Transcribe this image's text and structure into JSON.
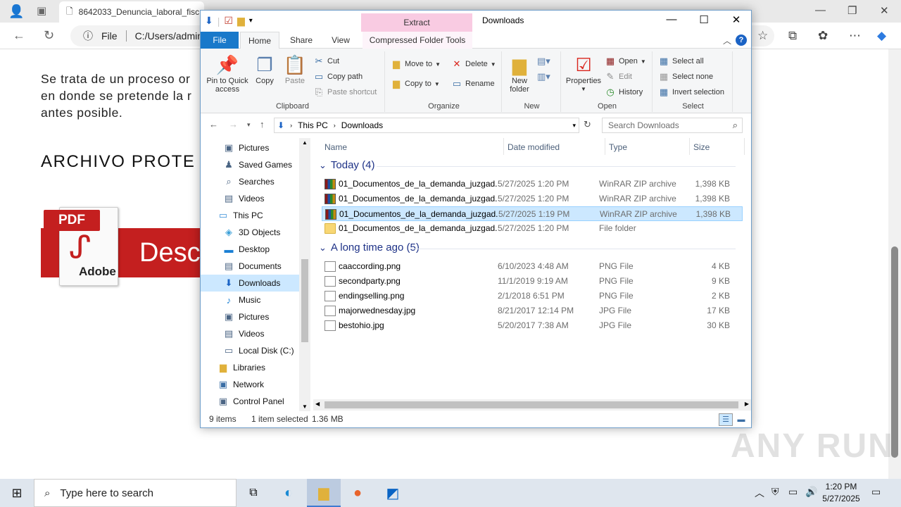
{
  "browser": {
    "tab_title": "8642033_Denuncia_laboral_fisc:",
    "address_label": "File",
    "address_value": "C:/Users/admin/",
    "page_text_lines": [
      "Se trata de un proceso or",
      "en donde se pretende la r",
      "antes posible."
    ],
    "page_heading": "ARCHIVO PROTE",
    "pdf_label": "PDF",
    "pdf_brand": "Adobe",
    "pdf_banner_text": "Desc"
  },
  "explorer": {
    "context_tab": "Extract",
    "window_title": "Downloads",
    "tabs": {
      "file": "File",
      "home": "Home",
      "share": "Share",
      "view": "View",
      "compressed": "Compressed Folder Tools"
    },
    "ribbon": {
      "clipboard": {
        "label": "Clipboard",
        "pin": "Pin to Quick access",
        "copy": "Copy",
        "paste": "Paste",
        "cut": "Cut",
        "copy_path": "Copy path",
        "paste_shortcut": "Paste shortcut"
      },
      "organize": {
        "label": "Organize",
        "move_to": "Move to",
        "copy_to": "Copy to",
        "delete": "Delete",
        "rename": "Rename"
      },
      "new": {
        "label": "New",
        "new_folder": "New folder"
      },
      "open": {
        "label": "Open",
        "properties": "Properties",
        "open": "Open",
        "edit": "Edit",
        "history": "History"
      },
      "select": {
        "label": "Select",
        "select_all": "Select all",
        "select_none": "Select none",
        "invert": "Invert selection"
      }
    },
    "breadcrumb": [
      "This PC",
      "Downloads"
    ],
    "search_placeholder": "Search Downloads",
    "nav_items": [
      {
        "label": "Pictures",
        "icon": "pictures-icon"
      },
      {
        "label": "Saved Games",
        "icon": "saved-games-icon"
      },
      {
        "label": "Searches",
        "icon": "searches-icon"
      },
      {
        "label": "Videos",
        "icon": "videos-icon"
      },
      {
        "label": "This PC",
        "icon": "computer-icon"
      },
      {
        "label": "3D Objects",
        "icon": "3d-objects-icon"
      },
      {
        "label": "Desktop",
        "icon": "desktop-icon"
      },
      {
        "label": "Documents",
        "icon": "documents-icon"
      },
      {
        "label": "Downloads",
        "icon": "downloads-icon"
      },
      {
        "label": "Music",
        "icon": "music-icon"
      },
      {
        "label": "Pictures",
        "icon": "pictures-icon"
      },
      {
        "label": "Videos",
        "icon": "videos-icon"
      },
      {
        "label": "Local Disk (C:)",
        "icon": "local-disk-icon"
      },
      {
        "label": "Libraries",
        "icon": "libraries-icon"
      },
      {
        "label": "Network",
        "icon": "network-icon"
      },
      {
        "label": "Control Panel",
        "icon": "control-panel-icon"
      }
    ],
    "columns": {
      "name": "Name",
      "date": "Date modified",
      "type": "Type",
      "size": "Size"
    },
    "groups": [
      {
        "title": "Today (4)",
        "files": [
          {
            "name": "01_Documentos_de_la_demanda_juzgad...",
            "date": "5/27/2025 1:20 PM",
            "type": "WinRAR ZIP archive",
            "size": "1,398 KB",
            "icon": "zip-icon"
          },
          {
            "name": "01_Documentos_de_la_demanda_juzgad...",
            "date": "5/27/2025 1:20 PM",
            "type": "WinRAR ZIP archive",
            "size": "1,398 KB",
            "icon": "zip-icon"
          },
          {
            "name": "01_Documentos_de_la_demanda_juzgad...",
            "date": "5/27/2025 1:19 PM",
            "type": "WinRAR ZIP archive",
            "size": "1,398 KB",
            "icon": "zip-icon"
          },
          {
            "name": "01_Documentos_de_la_demanda_juzgad...",
            "date": "5/27/2025 1:20 PM",
            "type": "File folder",
            "size": "",
            "icon": "folder-icon"
          }
        ]
      },
      {
        "title": "A long time ago (5)",
        "files": [
          {
            "name": "caaccording.png",
            "date": "6/10/2023 4:48 AM",
            "type": "PNG File",
            "size": "4 KB",
            "icon": "image-file-icon"
          },
          {
            "name": "secondparty.png",
            "date": "11/1/2019 9:19 AM",
            "type": "PNG File",
            "size": "9 KB",
            "icon": "image-file-icon"
          },
          {
            "name": "endingselling.png",
            "date": "2/1/2018 6:51 PM",
            "type": "PNG File",
            "size": "2 KB",
            "icon": "image-file-icon"
          },
          {
            "name": "majorwednesday.jpg",
            "date": "8/21/2017 12:14 PM",
            "type": "JPG File",
            "size": "17 KB",
            "icon": "image-file-icon"
          },
          {
            "name": "bestohio.jpg",
            "date": "5/20/2017 7:38 AM",
            "type": "JPG File",
            "size": "30 KB",
            "icon": "image-file-icon"
          }
        ]
      }
    ],
    "status": {
      "items": "9 items",
      "selected": "1 item selected",
      "size": "1.36 MB"
    }
  },
  "taskbar": {
    "search_placeholder": "Type here to search",
    "time": "1:20 PM",
    "date": "5/27/2025"
  },
  "watermark": "ANY RUN"
}
